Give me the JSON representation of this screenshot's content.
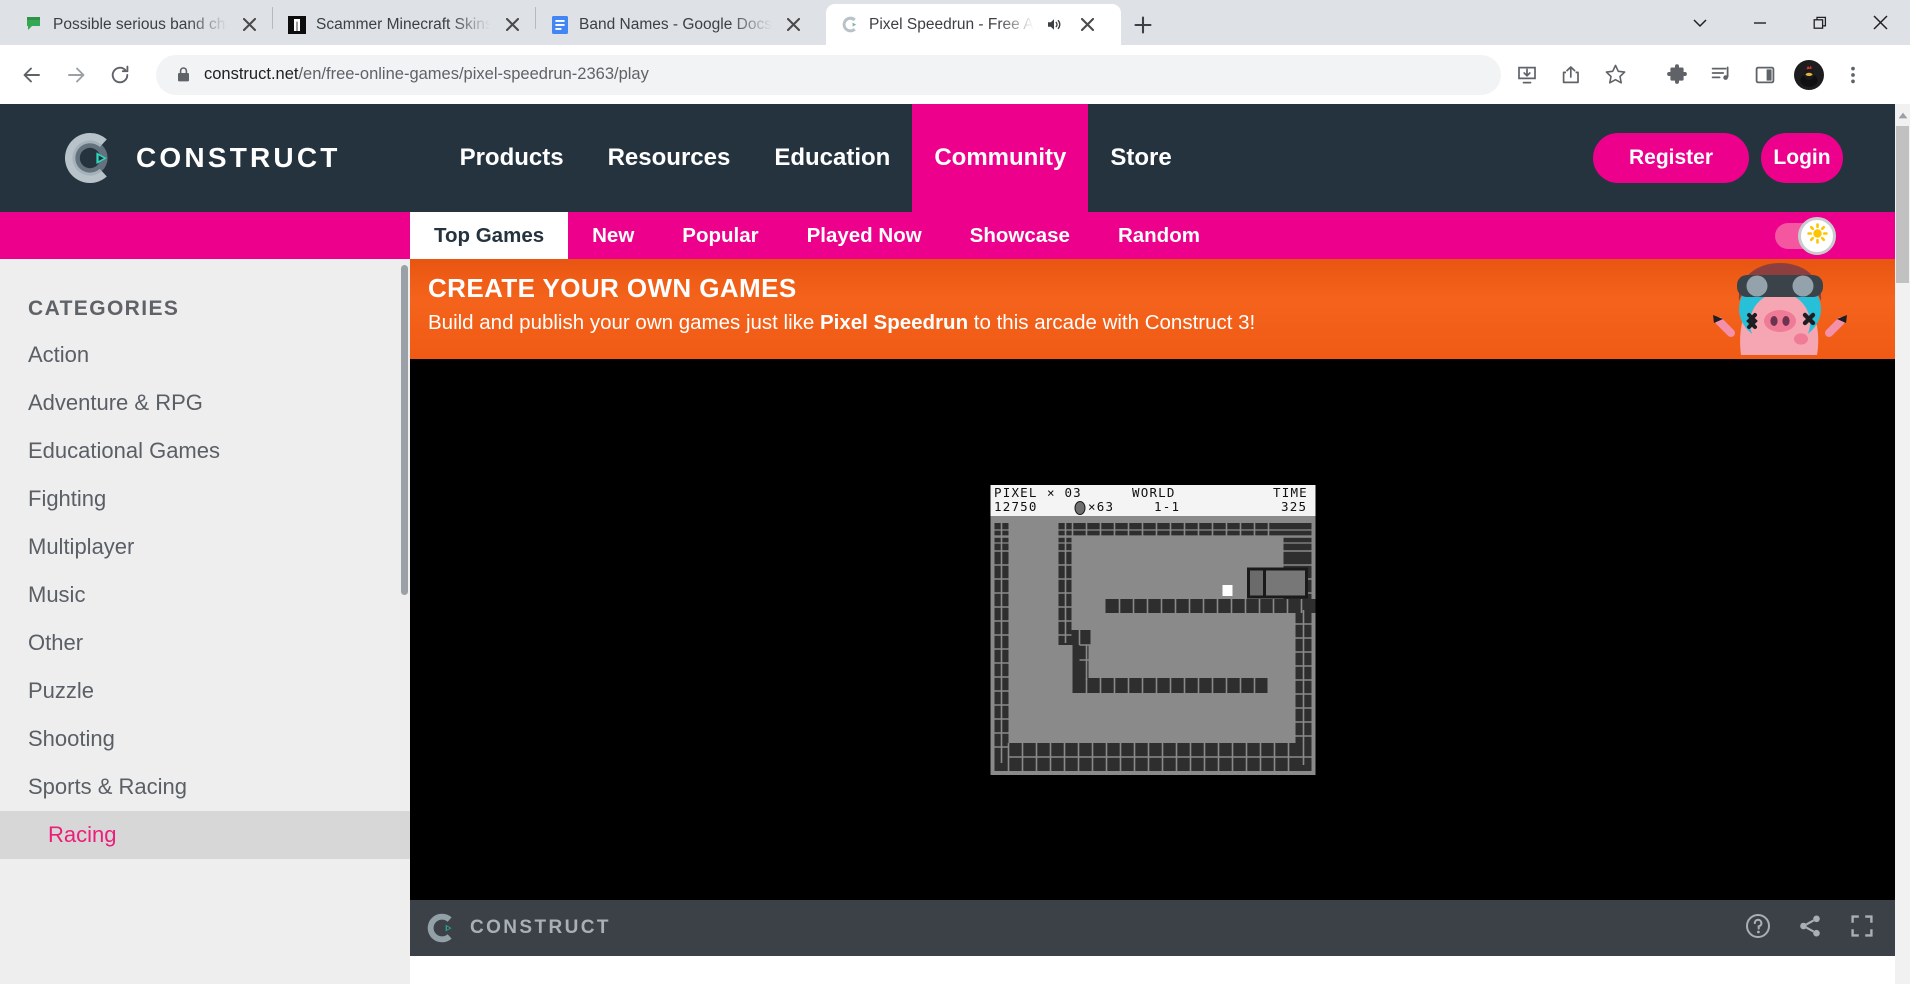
{
  "browser": {
    "tabs": [
      {
        "title": "Possible serious band chat - Cha",
        "favicon": "chat-icon",
        "active": false,
        "audio": false
      },
      {
        "title": "Scammer Minecraft Skins | Name",
        "favicon": "namemc-icon",
        "active": false,
        "audio": false
      },
      {
        "title": "Band Names - Google Docs",
        "favicon": "google-docs-icon",
        "active": false,
        "audio": false
      },
      {
        "title": "Pixel Speedrun - Free Addict",
        "favicon": "construct-icon",
        "active": true,
        "audio": true
      }
    ],
    "new_tab_label": "+",
    "window_controls": [
      "tab-search-icon",
      "minimize-icon",
      "restore-icon",
      "close-icon"
    ],
    "url_prefix": "construct.net",
    "url_suffix": "/en/free-online-games/pixel-speedrun-2363/play",
    "url_full": "construct.net/en/free-online-games/pixel-speedrun-2363/play",
    "toolbar_icons": [
      "back-icon",
      "forward-icon",
      "reload-icon"
    ],
    "action_icons": [
      "install-icon",
      "share-icon",
      "bookmark-star-icon",
      "extensions-puzzle-icon",
      "media-playlist-icon",
      "side-panel-icon",
      "profile-avatar",
      "three-dot-menu-icon"
    ]
  },
  "site": {
    "brand": "CONSTRUCT",
    "nav": [
      {
        "label": "Products",
        "active": false
      },
      {
        "label": "Resources",
        "active": false
      },
      {
        "label": "Education",
        "active": false
      },
      {
        "label": "Community",
        "active": true
      },
      {
        "label": "Store",
        "active": false
      }
    ],
    "register_label": "Register",
    "login_label": "Login",
    "subnav": [
      {
        "label": "Top Games",
        "active": true
      },
      {
        "label": "New",
        "active": false
      },
      {
        "label": "Popular",
        "active": false
      },
      {
        "label": "Played Now",
        "active": false
      },
      {
        "label": "Showcase",
        "active": false
      },
      {
        "label": "Random",
        "active": false
      }
    ],
    "theme_toggle": {
      "icon": "sun-icon",
      "state": "on"
    }
  },
  "sidebar": {
    "title": "CATEGORIES",
    "items": [
      {
        "label": "Action"
      },
      {
        "label": "Adventure & RPG"
      },
      {
        "label": "Educational Games"
      },
      {
        "label": "Fighting"
      },
      {
        "label": "Multiplayer"
      },
      {
        "label": "Music"
      },
      {
        "label": "Other"
      },
      {
        "label": "Puzzle"
      },
      {
        "label": "Shooting"
      },
      {
        "label": "Sports & Racing"
      }
    ],
    "sub_item": {
      "label": "Racing"
    }
  },
  "banner": {
    "heading": "CREATE YOUR OWN GAMES",
    "text_before": "Build and publish your own games just like ",
    "game_name": "Pixel Speedrun",
    "text_after": " to this arcade with Construct 3!",
    "mascot": "pig-character-icon"
  },
  "game": {
    "hud": {
      "player_label": "PIXEL",
      "lives_mult": "× 03",
      "world_label": "WORLD",
      "time_label": "TIME",
      "score": "12750",
      "coins": "×63",
      "world_value": "1-1",
      "time_value": "325"
    },
    "footer": {
      "brand": "CONSTRUCT",
      "icons": [
        "help-icon",
        "share-icon",
        "fullscreen-icon"
      ]
    }
  },
  "colors": {
    "brand_pink": "#ec008c",
    "header_dark": "#25333f",
    "banner_orange": "#f05a14",
    "sidebar_bg": "#eeeeee",
    "sub_active_pink": "#ec1e79"
  }
}
